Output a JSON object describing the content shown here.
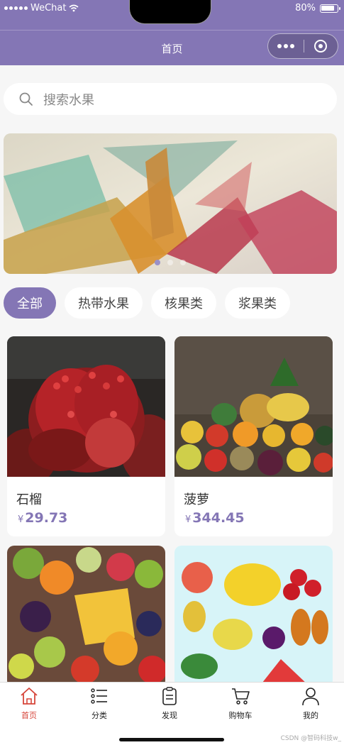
{
  "status_bar": {
    "carrier": "WeChat",
    "battery": "80%"
  },
  "navbar": {
    "title": "首页"
  },
  "search": {
    "placeholder": "搜索水果"
  },
  "banner": {
    "slide_count": 3,
    "active_index": 0
  },
  "categories": [
    {
      "label": "全部",
      "active": true
    },
    {
      "label": "热带水果",
      "active": false
    },
    {
      "label": "核果类",
      "active": false
    },
    {
      "label": "浆果类",
      "active": false
    }
  ],
  "products": [
    {
      "name": "石榴",
      "currency": "¥",
      "price": "29.73",
      "image": "pomegranate-photo"
    },
    {
      "name": "菠萝",
      "currency": "¥",
      "price": "344.45",
      "image": "fruit-pile-photo"
    },
    {
      "name": "",
      "currency": "",
      "price": "",
      "image": "fruit-platter-photo"
    },
    {
      "name": "",
      "currency": "",
      "price": "",
      "image": "fruit-illustration"
    }
  ],
  "tabbar": {
    "items": [
      {
        "label": "首页",
        "icon": "home-icon",
        "active": true
      },
      {
        "label": "分类",
        "icon": "list-icon",
        "active": false
      },
      {
        "label": "发现",
        "icon": "clipboard-icon",
        "active": false
      },
      {
        "label": "购物车",
        "icon": "cart-icon",
        "active": false
      },
      {
        "label": "我的",
        "icon": "user-icon",
        "active": false
      }
    ]
  },
  "watermark": "CSDN @智码科技w_",
  "colors": {
    "brand": "#8476b5",
    "active_tab": "#d6453a",
    "price": "#8476b5"
  }
}
